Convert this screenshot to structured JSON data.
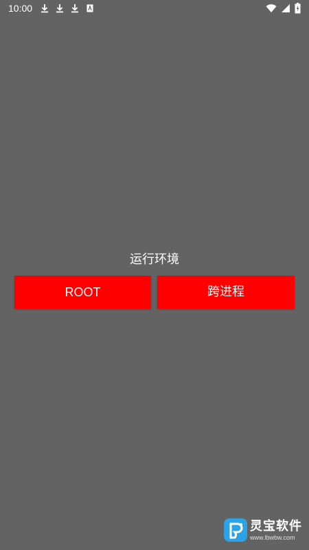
{
  "status_bar": {
    "time": "10:00",
    "left_icons": [
      "download-icon",
      "download-icon",
      "download-icon",
      "file-icon"
    ],
    "right_icons": [
      "wifi-icon",
      "signal-icon",
      "battery-icon"
    ]
  },
  "main": {
    "env_label": "运行环境",
    "buttons": {
      "root_label": "ROOT",
      "cross_process_label": "跨进程"
    }
  },
  "watermark": {
    "title": "灵宝软件",
    "url": "www.lbwbw.com"
  },
  "colors": {
    "background": "#636363",
    "button": "#ff0000",
    "text": "#ffffff",
    "watermark_logo": "#2ba3e6"
  }
}
